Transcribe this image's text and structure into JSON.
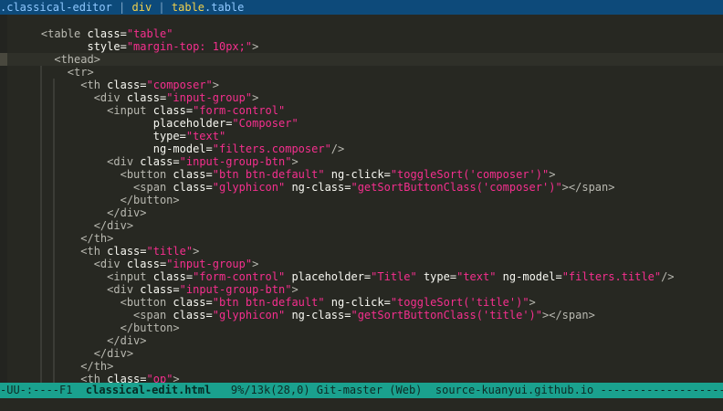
{
  "breadcrumb": {
    "segment1": ".classical-editor",
    "sep": " | ",
    "segment2": "div",
    "segment3_tag": "table",
    "segment3_cls": ".table"
  },
  "editor": {
    "lines": [
      [],
      [
        [
          "t",
          "    <"
        ],
        [
          "t",
          "table "
        ],
        [
          "a",
          "class="
        ],
        [
          "s",
          "\"table\""
        ]
      ],
      [
        [
          "a",
          "           style="
        ],
        [
          "s",
          "\"margin-top: 10px;\""
        ],
        [
          "t",
          ">"
        ]
      ],
      [
        [
          "t",
          "      <thead>"
        ]
      ],
      [
        [
          "t",
          "        <tr>"
        ]
      ],
      [
        [
          "t",
          "          <th "
        ],
        [
          "a",
          "class="
        ],
        [
          "s",
          "\"composer\""
        ],
        [
          "t",
          ">"
        ]
      ],
      [
        [
          "t",
          "            <div "
        ],
        [
          "a",
          "class="
        ],
        [
          "s",
          "\"input-group\""
        ],
        [
          "t",
          ">"
        ]
      ],
      [
        [
          "t",
          "              <input "
        ],
        [
          "a",
          "class="
        ],
        [
          "s",
          "\"form-control\""
        ]
      ],
      [
        [
          "a",
          "                     placeholder="
        ],
        [
          "s",
          "\"Composer\""
        ]
      ],
      [
        [
          "a",
          "                     type="
        ],
        [
          "s",
          "\"text\""
        ]
      ],
      [
        [
          "a",
          "                     ng-model="
        ],
        [
          "s",
          "\"filters.composer\""
        ],
        [
          "t",
          "/>"
        ]
      ],
      [
        [
          "t",
          "              <div "
        ],
        [
          "a",
          "class="
        ],
        [
          "s",
          "\"input-group-btn\""
        ],
        [
          "t",
          ">"
        ]
      ],
      [
        [
          "t",
          "                <button "
        ],
        [
          "a",
          "class="
        ],
        [
          "s",
          "\"btn btn-default\""
        ],
        [
          "a",
          " ng-click="
        ],
        [
          "s",
          "\"toggleSort('composer')\""
        ],
        [
          "t",
          ">"
        ]
      ],
      [
        [
          "t",
          "                  <span "
        ],
        [
          "a",
          "class="
        ],
        [
          "s",
          "\"glyphicon\""
        ],
        [
          "a",
          " ng-class="
        ],
        [
          "s",
          "\"getSortButtonClass('composer')\""
        ],
        [
          "t",
          "></span>"
        ]
      ],
      [
        [
          "t",
          "                </button>"
        ]
      ],
      [
        [
          "t",
          "              </div>"
        ]
      ],
      [
        [
          "t",
          "            </div>"
        ]
      ],
      [
        [
          "t",
          "          </th>"
        ]
      ],
      [
        [
          "t",
          "          <th "
        ],
        [
          "a",
          "class="
        ],
        [
          "s",
          "\"title\""
        ],
        [
          "t",
          ">"
        ]
      ],
      [
        [
          "t",
          "            <div "
        ],
        [
          "a",
          "class="
        ],
        [
          "s",
          "\"input-group\""
        ],
        [
          "t",
          ">"
        ]
      ],
      [
        [
          "t",
          "              <input "
        ],
        [
          "a",
          "class="
        ],
        [
          "s",
          "\"form-control\""
        ],
        [
          "a",
          " placeholder="
        ],
        [
          "s",
          "\"Title\""
        ],
        [
          "a",
          " type="
        ],
        [
          "s",
          "\"text\""
        ],
        [
          "a",
          " ng-model="
        ],
        [
          "s",
          "\"filters.title\""
        ],
        [
          "t",
          "/>"
        ]
      ],
      [
        [
          "t",
          "              <div "
        ],
        [
          "a",
          "class="
        ],
        [
          "s",
          "\"input-group-btn\""
        ],
        [
          "t",
          ">"
        ]
      ],
      [
        [
          "t",
          "                <button "
        ],
        [
          "a",
          "class="
        ],
        [
          "s",
          "\"btn btn-default\""
        ],
        [
          "a",
          " ng-click="
        ],
        [
          "s",
          "\"toggleSort('title')\""
        ],
        [
          "t",
          ">"
        ]
      ],
      [
        [
          "t",
          "                  <span "
        ],
        [
          "a",
          "class="
        ],
        [
          "s",
          "\"glyphicon\""
        ],
        [
          "a",
          " ng-class="
        ],
        [
          "s",
          "\"getSortButtonClass('title')\""
        ],
        [
          "t",
          "></span>"
        ]
      ],
      [
        [
          "t",
          "                </button>"
        ]
      ],
      [
        [
          "t",
          "              </div>"
        ]
      ],
      [
        [
          "t",
          "            </div>"
        ]
      ],
      [
        [
          "t",
          "          </th>"
        ]
      ],
      [
        [
          "t",
          "          <th "
        ],
        [
          "a",
          "class="
        ],
        [
          "s",
          "\"op\""
        ],
        [
          "t",
          ">"
        ]
      ]
    ]
  },
  "modeline": {
    "state": "-UU-:----F1  ",
    "filename": "classical-edit.html",
    "position": "   9%/13k(28,0)",
    "vc": " Git-master",
    "mode": " (Web)",
    "project": "  source-kuanyui.github.io",
    "fill": " -----------------------------------------------"
  },
  "colors": {
    "background": "#272822",
    "breadcrumb_bg": "#0d4a7a",
    "modeline_bg": "#1aa18e",
    "tag": "#b9b9b1",
    "attr": "#f8f8f2",
    "string": "#f52f8e"
  }
}
